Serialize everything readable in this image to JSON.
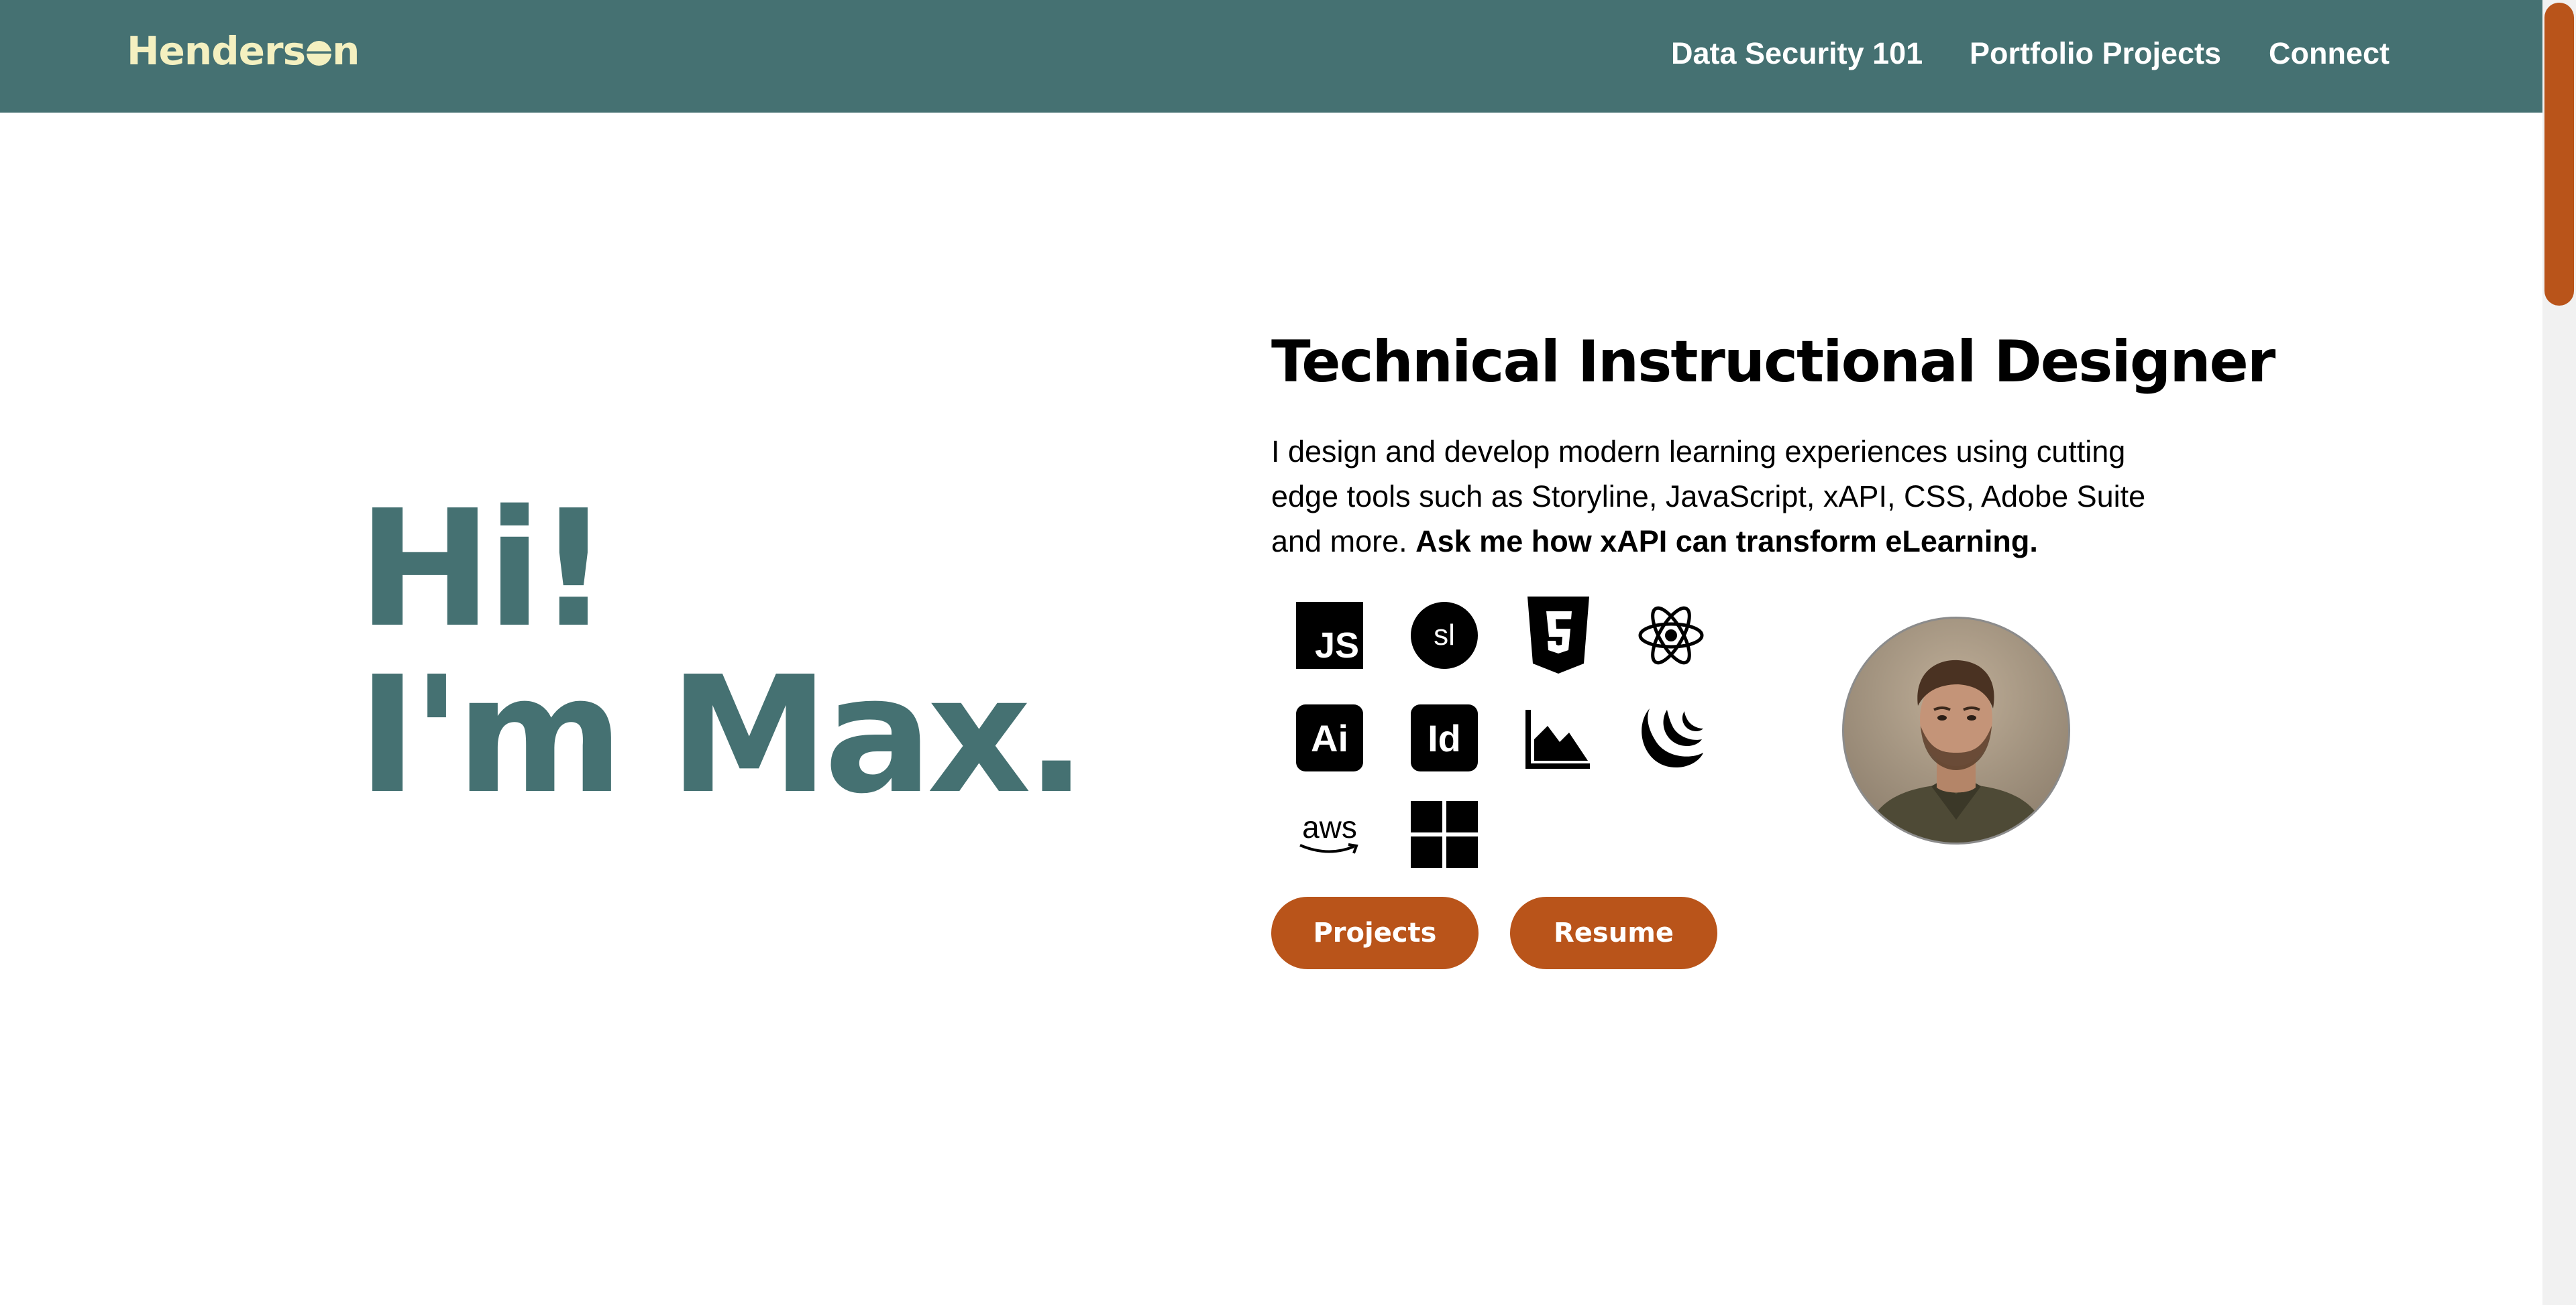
{
  "header": {
    "logo_part1": "Henders",
    "logo_part2": "n",
    "nav": [
      {
        "label": "Data Security 101"
      },
      {
        "label": "Portfolio Projects"
      },
      {
        "label": "Connect"
      }
    ]
  },
  "hero": {
    "line1": "Hi!",
    "line2": "I'm Max."
  },
  "about": {
    "title": "Technical Instructional Designer",
    "intro_text": "I design and develop modern learning experiences using cutting edge tools such as Storyline, JavaScript, xAPI, CSS, Adobe Suite and more. ",
    "intro_bold": "Ask me how xAPI can transform eLearning."
  },
  "skills": {
    "icons": [
      {
        "name": "javascript-icon",
        "text": "JS"
      },
      {
        "name": "storyline-icon",
        "text": "sl"
      },
      {
        "name": "html5-icon",
        "text": "5"
      },
      {
        "name": "react-icon"
      },
      {
        "name": "adobe-illustrator-icon",
        "text": "Ai"
      },
      {
        "name": "adobe-indesign-icon",
        "text": "Id"
      },
      {
        "name": "area-chart-icon"
      },
      {
        "name": "crescent-waves-icon"
      },
      {
        "name": "aws-icon",
        "text": "aws"
      },
      {
        "name": "windows-icon"
      }
    ]
  },
  "buttons": {
    "projects": "Projects",
    "resume": "Resume"
  },
  "colors": {
    "header_bg": "#457172",
    "logo": "#f4f0c0",
    "accent": "#b9541a",
    "hero_text": "#457172"
  }
}
